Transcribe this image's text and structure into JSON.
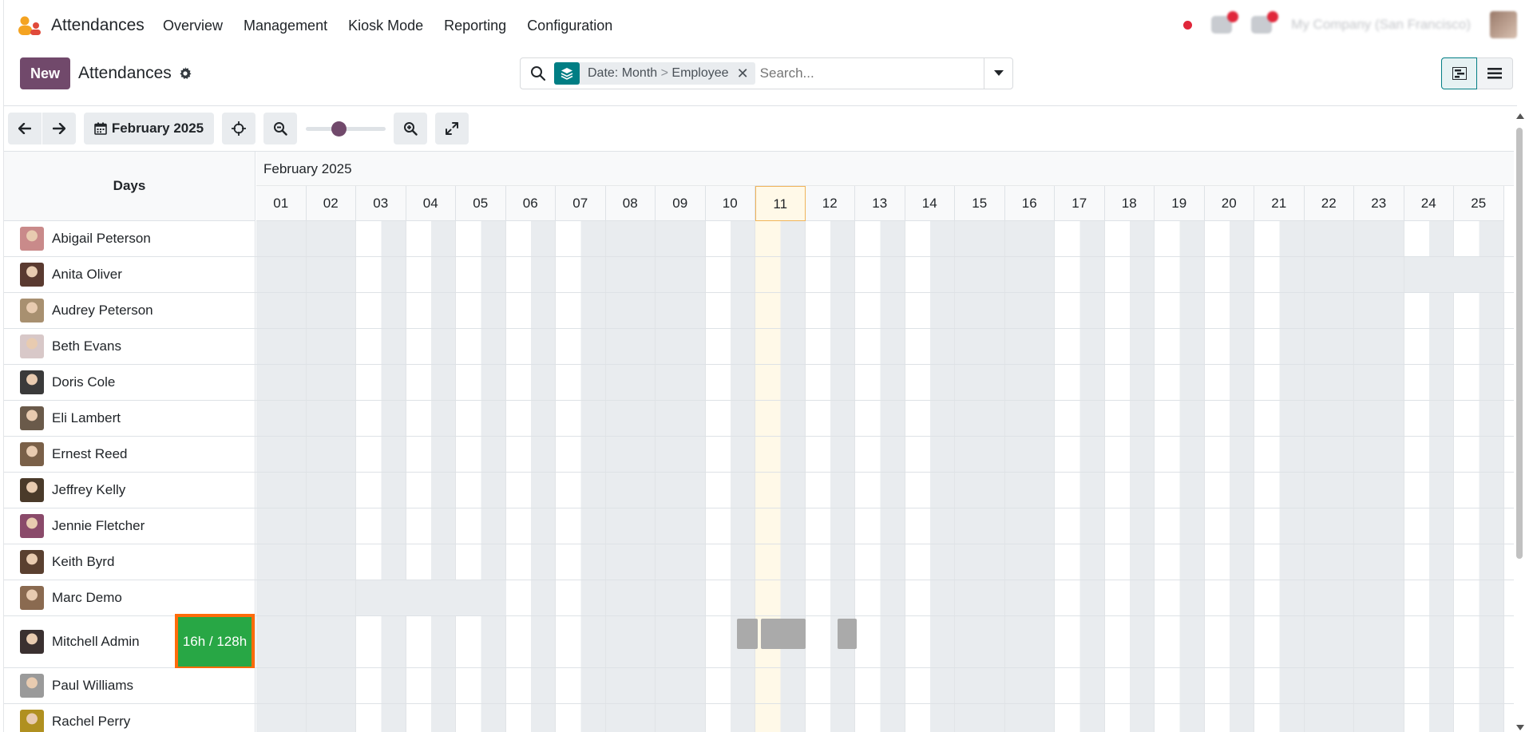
{
  "app": {
    "name": "Attendances",
    "menu": [
      "Overview",
      "Management",
      "Kiosk Mode",
      "Reporting",
      "Configuration"
    ],
    "company": "My Company (San Francisco)",
    "icons": {
      "logo": "attendances-logo",
      "chat": "chat-icon",
      "activity": "clock-icon"
    }
  },
  "control": {
    "new_label": "New",
    "breadcrumb": "Attendances",
    "search": {
      "facet_label": "Date: Month",
      "facet_sep": ">",
      "facet_label2": "Employee",
      "placeholder": "Search..."
    }
  },
  "toolbar": {
    "period_label": "February 2025"
  },
  "gantt": {
    "rows_header": "Days",
    "month_label": "February 2025",
    "days": [
      "01",
      "02",
      "03",
      "04",
      "05",
      "06",
      "07",
      "08",
      "09",
      "10",
      "11",
      "12",
      "13",
      "14",
      "15",
      "16",
      "17",
      "18",
      "19",
      "20",
      "21",
      "22",
      "23",
      "24",
      "25"
    ],
    "today": "11",
    "employees": [
      {
        "name": "Abigail Peterson"
      },
      {
        "name": "Anita Oliver"
      },
      {
        "name": "Audrey Peterson"
      },
      {
        "name": "Beth Evans"
      },
      {
        "name": "Doris Cole"
      },
      {
        "name": "Eli Lambert"
      },
      {
        "name": "Ernest Reed"
      },
      {
        "name": "Jeffrey Kelly"
      },
      {
        "name": "Jennie Fletcher"
      },
      {
        "name": "Keith Byrd"
      },
      {
        "name": "Marc Demo"
      },
      {
        "name": "Mitchell Admin",
        "total": "16h / 128h"
      },
      {
        "name": "Paul Williams"
      },
      {
        "name": "Rachel Perry"
      }
    ],
    "colors": {
      "accent": "#71496b",
      "teal": "#017e84",
      "total_bg": "#28a745",
      "total_border": "#ff6b0a",
      "today": "#fff9e8"
    }
  }
}
